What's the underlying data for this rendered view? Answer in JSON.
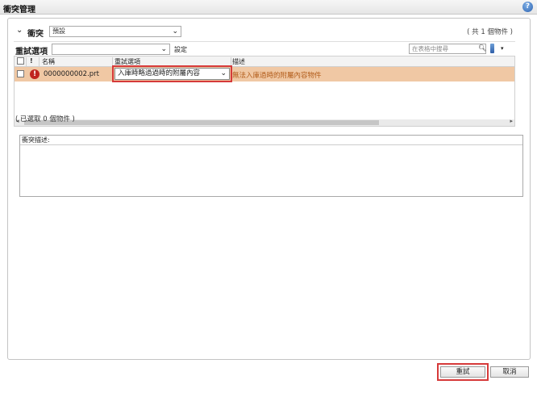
{
  "window": {
    "title": "衝突管理"
  },
  "conflict": {
    "label": "衝突",
    "view_value": "預設",
    "count_text": "( 共 1 個物件 )"
  },
  "retry_options": {
    "label": "重試選項",
    "dropdown_value": "",
    "set_label": "設定",
    "search_placeholder": "在表格中搜尋"
  },
  "table": {
    "columns": [
      "名稱",
      "重試選項",
      "描述"
    ],
    "rows": [
      {
        "name": "0000000002.prt",
        "retry_option": "入庫時略過過時的附屬內容",
        "description": "無法入庫過時的附屬內容物件"
      }
    ]
  },
  "selected_text": "( 已選取 0 個物件 )",
  "conflict_description": {
    "label": "衝突描述:"
  },
  "buttons": {
    "retry": "重試",
    "cancel": "取消"
  }
}
